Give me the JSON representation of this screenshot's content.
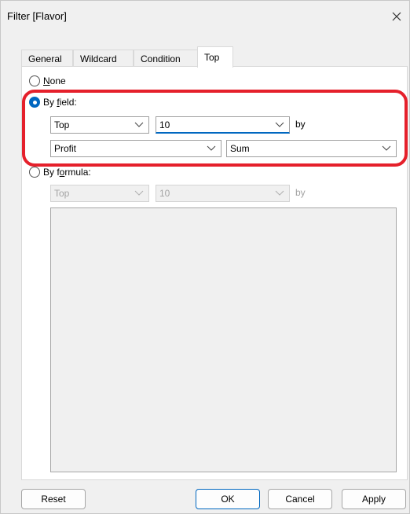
{
  "window": {
    "title": "Filter [Flavor]"
  },
  "tabs": [
    {
      "label": "General"
    },
    {
      "label": "Wildcard"
    },
    {
      "label": "Condition"
    },
    {
      "label": "Top"
    }
  ],
  "active_tab": "Top",
  "options": {
    "none": {
      "label_pre": "",
      "label_u": "N",
      "label_post": "one",
      "checked": false
    },
    "by_field": {
      "label_pre": "By ",
      "label_u": "f",
      "label_post": "ield:",
      "checked": true
    },
    "by_formula": {
      "label_pre": "By f",
      "label_u": "o",
      "label_post": "rmula:",
      "checked": false
    }
  },
  "by_field": {
    "direction": "Top",
    "count": "10",
    "by_label": "by",
    "field": "Profit",
    "aggregation": "Sum"
  },
  "by_formula": {
    "direction": "Top",
    "count": "10",
    "by_label": "by"
  },
  "buttons": {
    "reset": "Reset",
    "ok": "OK",
    "cancel": "Cancel",
    "apply": "Apply"
  },
  "colors": {
    "accent": "#0067c0",
    "highlight": "#e5202b"
  }
}
